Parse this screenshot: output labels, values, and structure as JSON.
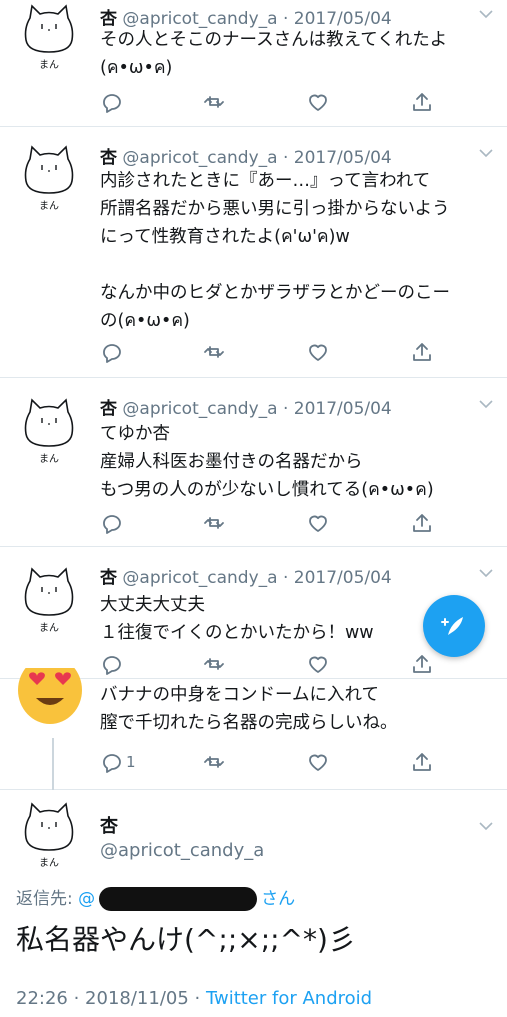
{
  "colors": {
    "accent": "#1da1f2",
    "muted": "#657786",
    "text": "#14171a"
  },
  "icons": {
    "reply": "reply-icon",
    "retweet": "retweet-icon",
    "like": "heart-icon",
    "share": "share-icon",
    "chevron": "chevron-down-icon",
    "compose": "compose-icon"
  },
  "tweets": [
    {
      "name": "杏",
      "meta": "@apricot_candy_a · 2017/05/04",
      "avatar_label": "まん",
      "text": "その人とそこのナースさんは教えてくれたよ\n(ค•ω•ค)"
    },
    {
      "name": "杏",
      "meta": "@apricot_candy_a · 2017/05/04",
      "avatar_label": "まん",
      "text": "内診されたときに『あー…』って言われて\n所謂名器だから悪い男に引っ掛からないよう\nにって性教育されたよ(ค'ω'ค)w\n\nなんか中のヒダとかザラザラとかどーのこー\nの(ค•ω•ค)"
    },
    {
      "name": "杏",
      "meta": "@apricot_candy_a · 2017/05/04",
      "avatar_label": "まん",
      "text": "てゆか杏\n産婦人科医お墨付きの名器だから\nもつ男の人のが少ないし慣れてる(ค•ω•ค)"
    },
    {
      "name": "杏",
      "meta": "@apricot_candy_a · 2017/05/04",
      "avatar_label": "まん",
      "text": "大丈夫大丈夫\n１往復でイくのとかいたから！ww"
    },
    {
      "text": "バナナの中身をコンドームに入れて\n膣で千切れたら名器の完成らしいね。",
      "reply_count": "1"
    }
  ],
  "main_tweet": {
    "name": "杏",
    "handle": "@apricot_candy_a",
    "avatar_label": "まん",
    "reply_label": "返信先:",
    "reply_mention_prefix": "@",
    "reply_mention_suffix": "さん",
    "text": "私名器やんけ(^;;×;;^*)彡",
    "timestamp": "22:26 · 2018/11/05 · ",
    "source": "Twitter for Android"
  }
}
